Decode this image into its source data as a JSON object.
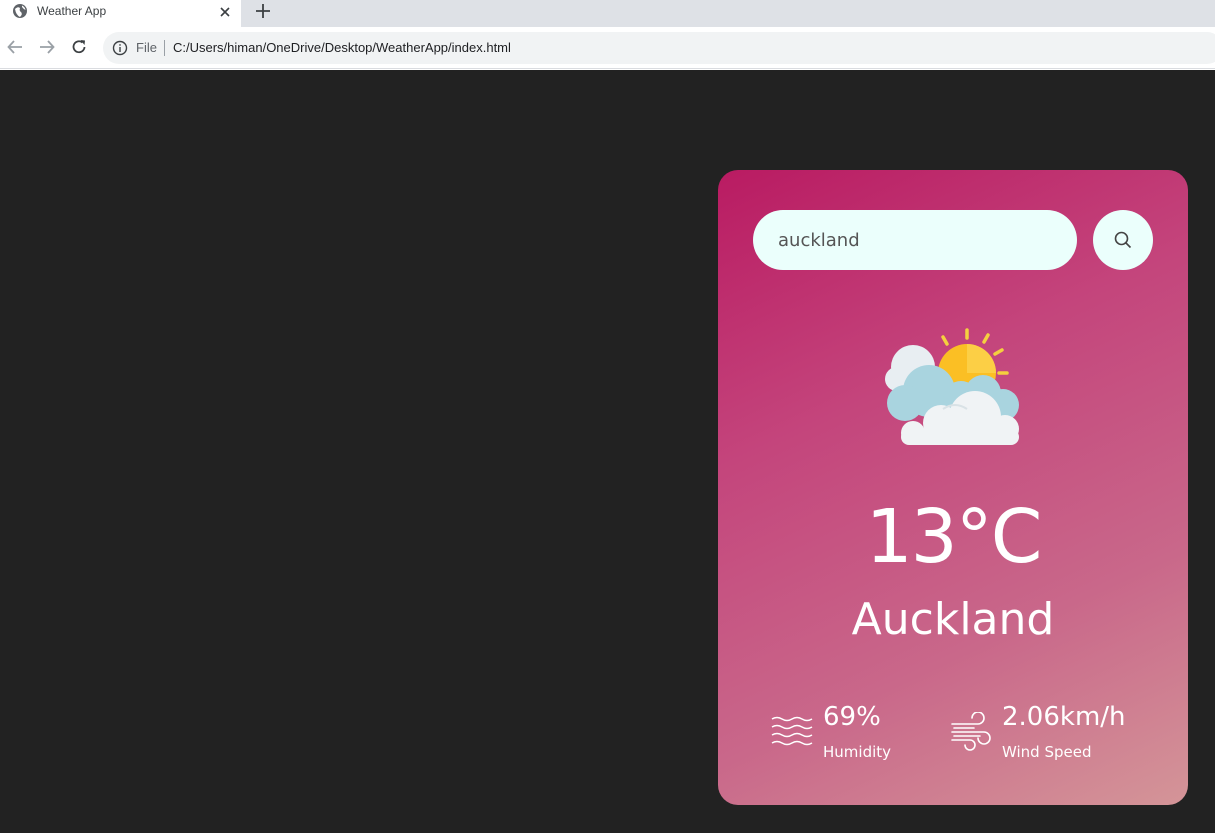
{
  "browser": {
    "tab_title": "Weather App",
    "omnibox_scheme": "File",
    "url": "C:/Users/himan/OneDrive/Desktop/WeatherApp/index.html"
  },
  "search": {
    "value": "auckland"
  },
  "weather": {
    "icon": "partly-cloudy-sun-icon",
    "temperature": "13°C",
    "city": "Auckland",
    "humidity": "69%",
    "humidity_label": "Humidity",
    "wind_speed": "2.06km/h",
    "wind_label": "Wind Speed"
  },
  "colors": {
    "page_background": "#222222",
    "card_gradient_start": "#b91b62",
    "card_gradient_end": "#d49598",
    "input_background": "#ebfffc"
  }
}
